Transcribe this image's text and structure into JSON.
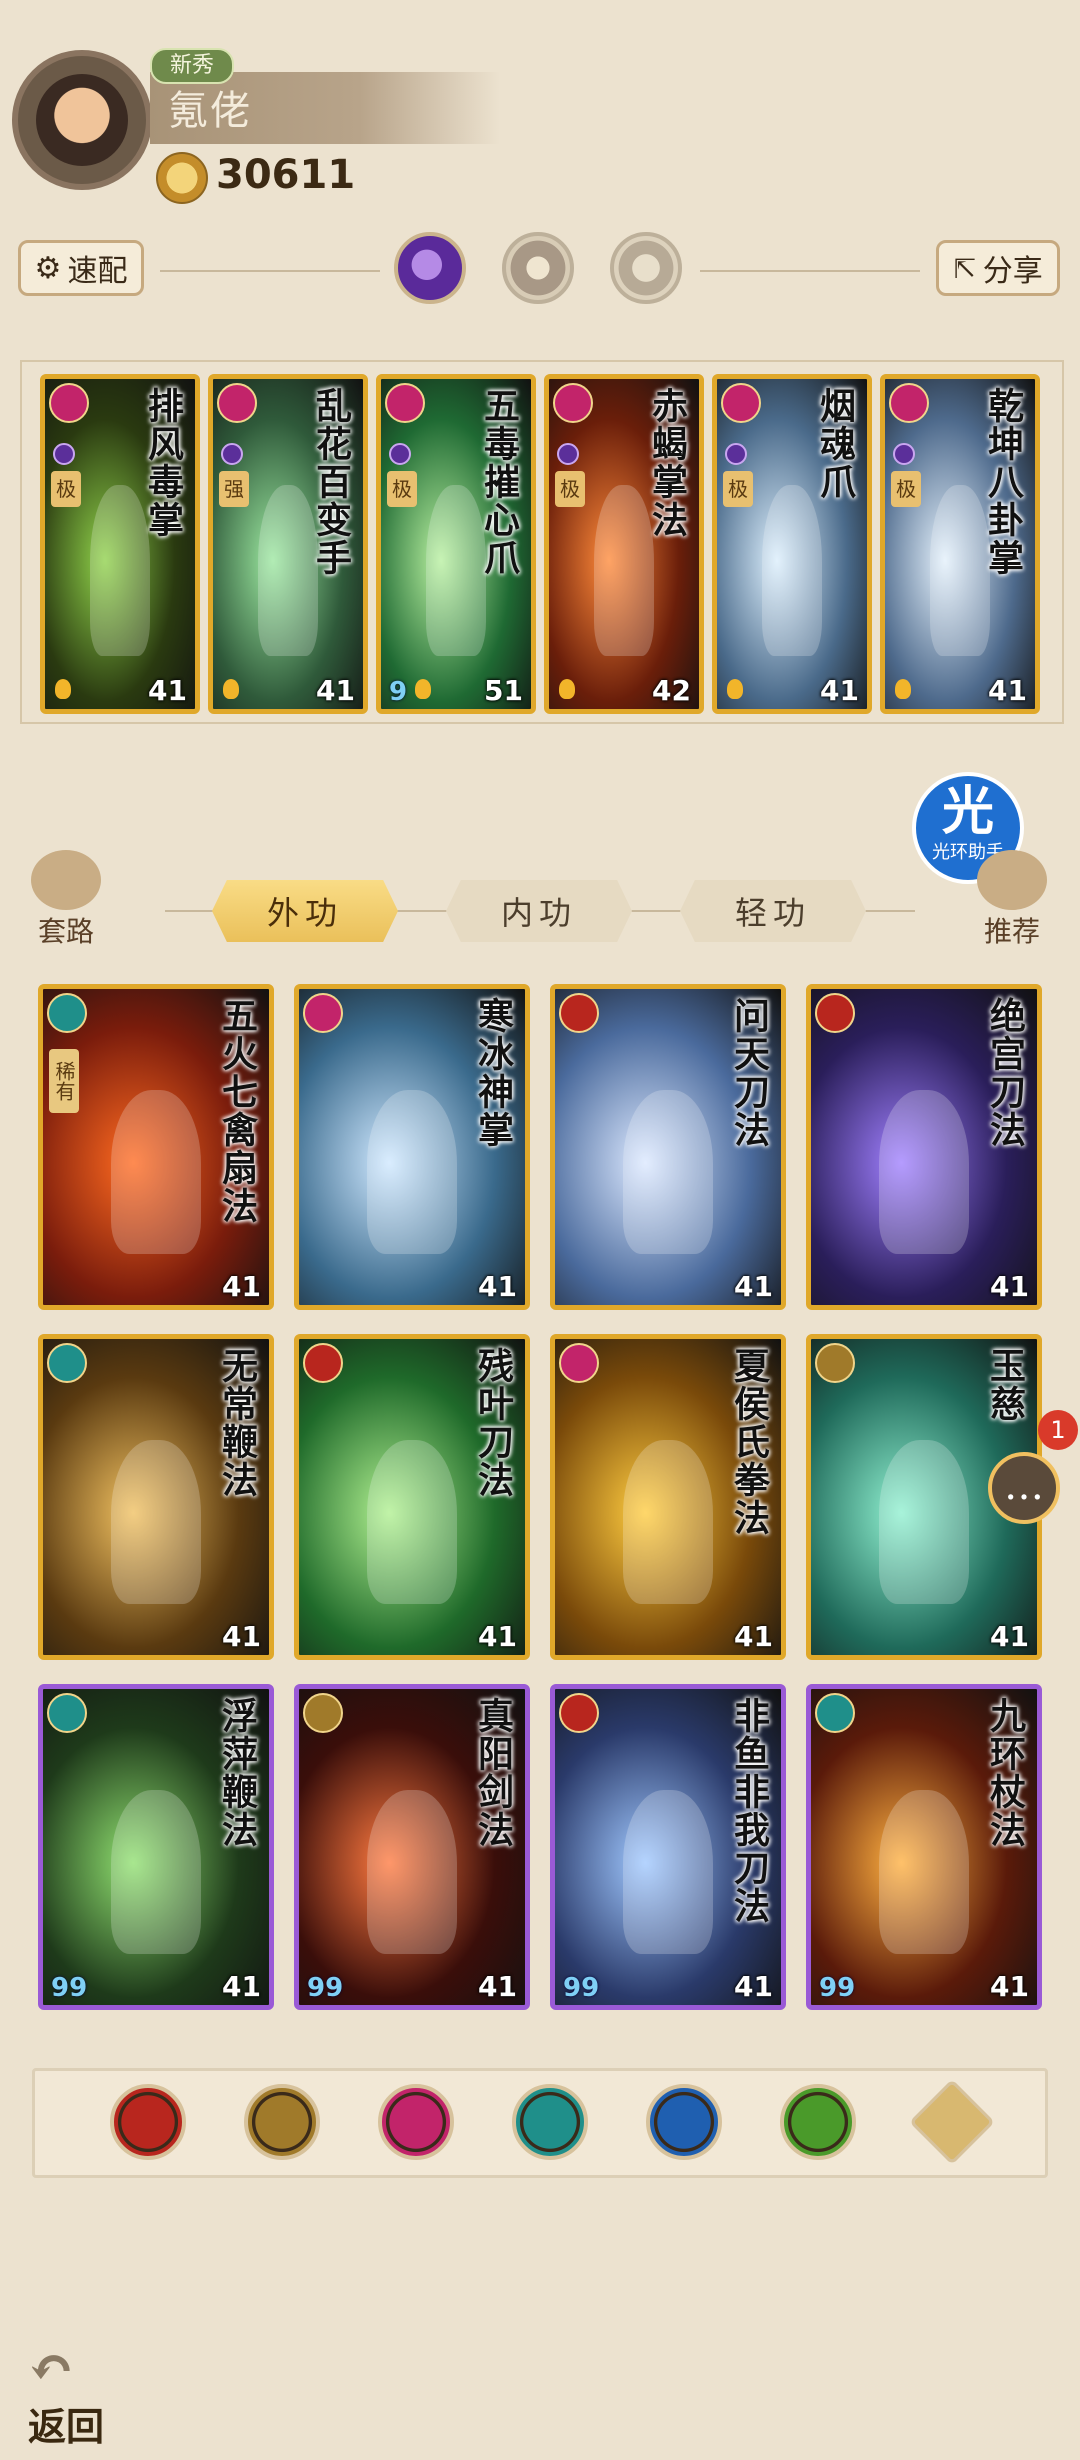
{
  "header": {
    "badge": "新秀",
    "player_name": "氪佬",
    "power": "30611"
  },
  "controls": {
    "quick_config": "速配",
    "share": "分享"
  },
  "equipped": [
    {
      "name": "排风毒掌",
      "level": "41",
      "tag": "极",
      "bg": "#2a3a10",
      "accent": "#8fd14a",
      "type_color": "#c2246a"
    },
    {
      "name": "乱花百变手",
      "level": "41",
      "tag": "强",
      "bg": "#2f5a3a",
      "accent": "#9ce7a0",
      "type_color": "#c2246a"
    },
    {
      "name": "五毒摧心爪",
      "level": "51",
      "tag": "极",
      "bg": "#1f6a33",
      "accent": "#b8f0a0",
      "type_color": "#c2246a",
      "nine": "9"
    },
    {
      "name": "赤蝎掌法",
      "level": "42",
      "tag": "极",
      "bg": "#6a1e0a",
      "accent": "#ff8a3a",
      "type_color": "#c2246a"
    },
    {
      "name": "烟魂爪",
      "level": "41",
      "tag": "极",
      "bg": "#4a6a8a",
      "accent": "#dbeefc",
      "type_color": "#c2246a"
    },
    {
      "name": "乾坤八卦掌",
      "level": "41",
      "tag": "极",
      "bg": "#4e6a8c",
      "accent": "#e3f0fb",
      "type_color": "#c2246a"
    }
  ],
  "side": {
    "left_label": "套路",
    "right_label": "推荐",
    "halo_badge": "光",
    "halo_text": "光环助手"
  },
  "tabs": [
    "外功",
    "内功",
    "轻功"
  ],
  "skills": [
    {
      "name": "五火七禽扇法",
      "level": "41",
      "rarity": "gold",
      "bg": "#7a1c0c",
      "accent": "#ff6a20",
      "type_color": "#1f8f8a",
      "tag": "稀有"
    },
    {
      "name": "寒冰神掌",
      "level": "41",
      "rarity": "gold",
      "bg": "#3a6a8c",
      "accent": "#cfe8ff",
      "type_color": "#c2246a"
    },
    {
      "name": "问天刀法",
      "level": "41",
      "rarity": "gold",
      "bg": "#4a6a9c",
      "accent": "#dbe8ff",
      "type_color": "#b8261e"
    },
    {
      "name": "绝宫刀法",
      "level": "41",
      "rarity": "gold",
      "bg": "#2a1e5a",
      "accent": "#a080ff",
      "type_color": "#b8261e"
    },
    {
      "name": "无常鞭法",
      "level": "41",
      "rarity": "gold",
      "bg": "#5a3a10",
      "accent": "#f0c060",
      "type_color": "#1f8f8a"
    },
    {
      "name": "残叶刀法",
      "level": "41",
      "rarity": "gold",
      "bg": "#1f6a2a",
      "accent": "#b0f090",
      "type_color": "#b8261e"
    },
    {
      "name": "夏侯氏拳法",
      "level": "41",
      "rarity": "gold",
      "bg": "#7a4a0a",
      "accent": "#ffcc40",
      "type_color": "#c2246a"
    },
    {
      "name": "玉慈",
      "level": "41",
      "rarity": "gold",
      "bg": "#1f6a5a",
      "accent": "#90f0d0",
      "type_color": "#a07a2a"
    },
    {
      "name": "浮萍鞭法",
      "level": "41",
      "rarity": "purple",
      "bg": "#1e3a1a",
      "accent": "#90e070",
      "type_color": "#1f8f8a",
      "nine": "99"
    },
    {
      "name": "真阳剑法",
      "level": "41",
      "rarity": "purple",
      "bg": "#3a0e0a",
      "accent": "#ff7a40",
      "type_color": "#a07a2a",
      "nine": "99"
    },
    {
      "name": "非鱼非我刀法",
      "level": "41",
      "rarity": "purple",
      "bg": "#2a3a6a",
      "accent": "#a0c8ff",
      "type_color": "#b8261e",
      "nine": "99"
    },
    {
      "name": "九环杖法",
      "level": "41",
      "rarity": "purple",
      "bg": "#5a1a0a",
      "accent": "#ffb040",
      "type_color": "#1f8f8a",
      "nine": "99"
    }
  ],
  "filters": [
    {
      "name": "blade-filter-icon",
      "color": "#b8261e"
    },
    {
      "name": "sword-filter-icon",
      "color": "#a07a2a"
    },
    {
      "name": "palm-filter-icon",
      "color": "#c2246a"
    },
    {
      "name": "fan-filter-icon",
      "color": "#1f8f8a"
    },
    {
      "name": "taiji-filter-icon",
      "color": "#1f5fb0"
    },
    {
      "name": "whip-filter-icon",
      "color": "#4a9a2a"
    },
    {
      "name": "expand-filter-icon",
      "color": "#d8b870"
    }
  ],
  "notification": {
    "count": "1"
  },
  "footer": {
    "back_label": "返回"
  }
}
